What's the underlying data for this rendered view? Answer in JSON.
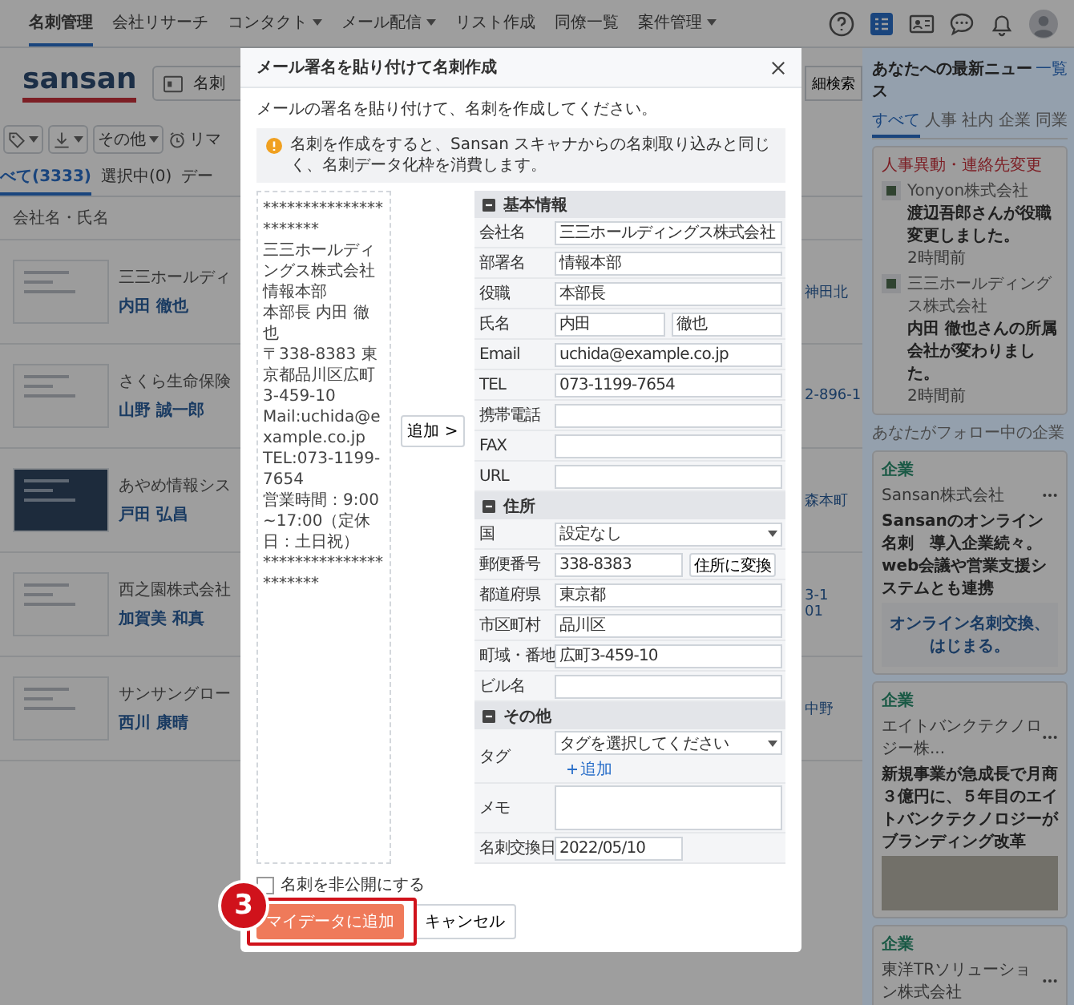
{
  "top_nav": {
    "items": [
      {
        "label": "名刺管理",
        "selected": true,
        "dropdown": false
      },
      {
        "label": "会社リサーチ",
        "selected": false,
        "dropdown": false
      },
      {
        "label": "コンタクト",
        "selected": false,
        "dropdown": true
      },
      {
        "label": "メール配信",
        "selected": false,
        "dropdown": true
      },
      {
        "label": "リスト作成",
        "selected": false,
        "dropdown": false
      },
      {
        "label": "同僚一覧",
        "selected": false,
        "dropdown": false
      },
      {
        "label": "案件管理",
        "selected": false,
        "dropdown": true
      }
    ]
  },
  "card_list": {
    "logo": "sansan",
    "search_scope": "名刺",
    "detail_search": "細検索",
    "other_menu": "その他",
    "reminder": "リマ",
    "tabs": [
      {
        "label": "べて(3333)",
        "selected": true
      },
      {
        "label": "選択中(0)",
        "selected": false
      },
      {
        "label": "デー",
        "selected": false
      }
    ],
    "filter_placeholder": "会社名・氏名",
    "rows": [
      {
        "company": "三三ホールディ",
        "name": "内田 徹也",
        "kind": "light",
        "address": [
          "神田北"
        ]
      },
      {
        "company": "さくら生命保険",
        "name": "山野 誠一郎",
        "kind": "light",
        "address": [
          "2-896-1"
        ]
      },
      {
        "company": "あやめ情報シス",
        "name": "戸田 弘昌",
        "kind": "dark",
        "address": [
          "森本町"
        ]
      },
      {
        "company": "西之園株式会社",
        "name": "加賀美 和真",
        "kind": "light",
        "address": [
          "3-1",
          "01"
        ]
      },
      {
        "company": "サンサングロー",
        "name": "西川 康晴",
        "kind": "light",
        "address": [
          "中野"
        ]
      }
    ]
  },
  "news": {
    "title": "あなたへの最新ニュース",
    "link": "一覧",
    "tabs": [
      {
        "label": "すべて",
        "selected": true
      },
      {
        "label": "人事",
        "selected": false
      },
      {
        "label": "社内",
        "selected": false
      },
      {
        "label": "企業",
        "selected": false
      },
      {
        "label": "同業",
        "selected": false
      }
    ],
    "personnel": {
      "label": "人事異動・連絡先変更",
      "items": [
        {
          "company": "Yonyon株式会社",
          "message": "渡辺吾郎さんが役職変更しました。",
          "time": "2時間前"
        },
        {
          "company": "三三ホールディングス株式会社",
          "message": "内田 徹也さんの所属会社が変わりました。",
          "time": "2時間前"
        }
      ]
    },
    "following_label": "あなたがフォロー中の企業",
    "articles": [
      {
        "tag": "企業",
        "company": "Sansan株式会社",
        "headline": "Sansanのオンライン名刺　導入企業続々。web会議や営業支援システムとも連携",
        "kind": "banner",
        "banner_text": "オンライン名刺交換、はじまる。"
      },
      {
        "tag": "企業",
        "company": "エイトバンクテクノロジー株...",
        "headline": "新規事業が急成長で月商３億円に、５年目のエイトバンクテクノロジーがブランディング改革",
        "kind": "photo"
      },
      {
        "tag": "企業",
        "company": "東洋TRソリューション株式会社",
        "kind": "plain"
      }
    ]
  },
  "modal": {
    "title": "メール署名を貼り付けて名刺作成",
    "intro": "メールの署名を貼り付けて、名刺を作成してください。",
    "notice": "名刺を作成をすると、Sansan スキャナからの名刺取り込みと同じく、名刺データ化枠を消費します。",
    "signature": [
      "**********************",
      "三三ホールディングス株式会社",
      "情報本部",
      "本部長 内田 徹也",
      "〒338-8383 東京都品川区広町3-459-10",
      "Mail:uchida@example.co.jp",
      "TEL:073-1199-7654",
      "営業時間：9:00~17:00（定休日：土日祝）",
      "**********************"
    ],
    "add_button": "追加 >",
    "sections": [
      {
        "title": "基本情報",
        "fields": [
          {
            "label": "会社名",
            "kind": "text",
            "value": "三三ホールディングス株式会社"
          },
          {
            "label": "部署名",
            "kind": "text",
            "value": "情報本部"
          },
          {
            "label": "役職",
            "kind": "text",
            "value": "本部長"
          },
          {
            "label": "氏名",
            "kind": "name",
            "values": [
              "内田",
              "徹也"
            ]
          },
          {
            "label": "Email",
            "kind": "text",
            "value": "uchida@example.co.jp"
          },
          {
            "label": "TEL",
            "kind": "text",
            "value": "073-1199-7654"
          },
          {
            "label": "携帯電話",
            "kind": "text"
          },
          {
            "label": "FAX",
            "kind": "text"
          },
          {
            "label": "URL",
            "kind": "text"
          }
        ]
      },
      {
        "title": "住所",
        "fields": [
          {
            "label": "国",
            "kind": "select",
            "value": "設定なし"
          },
          {
            "label": "郵便番号",
            "kind": "postal",
            "value": "338-8383",
            "button": "住所に変換"
          },
          {
            "label": "都道府県",
            "kind": "text",
            "value": "東京都"
          },
          {
            "label": "市区町村",
            "kind": "text",
            "value": "品川区"
          },
          {
            "label": "町域・番地",
            "kind": "text",
            "value": "広町3-459-10"
          },
          {
            "label": "ビル名",
            "kind": "text"
          }
        ]
      },
      {
        "title": "その他",
        "fields": [
          {
            "label": "タグ",
            "kind": "tag",
            "placeholder": "タグを選択してください",
            "link": "追加"
          },
          {
            "label": "メモ",
            "kind": "memo"
          },
          {
            "label": "名刺交換日",
            "kind": "date",
            "value": "2022/05/10"
          }
        ]
      }
    ],
    "private_checkbox": {
      "label": "名刺を非公開にする",
      "checked": false
    },
    "primary_button": "マイデータに追加",
    "cancel_button": "キャンセル",
    "step_badge": "3"
  }
}
